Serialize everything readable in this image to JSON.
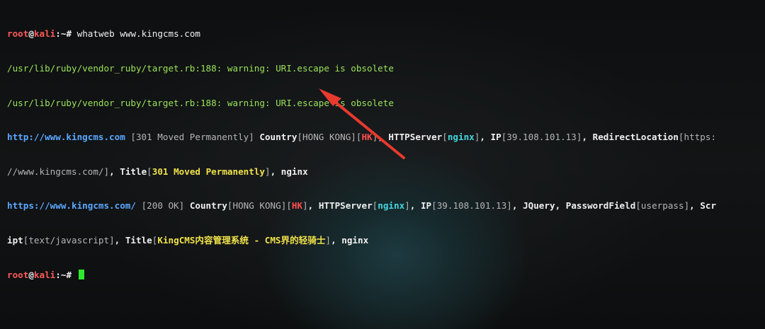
{
  "line1": {
    "user": "root",
    "at": "@",
    "host": "kali",
    "path": ":~# ",
    "cmd": "whatweb www.kingcms.com"
  },
  "line2": "/usr/lib/ruby/vendor_ruby/target.rb:188: warning: URI.escape is obsolete",
  "line3": "/usr/lib/ruby/vendor_ruby/target.rb:188: warning: URI.escape is obsolete",
  "r1": {
    "url": "http://www.kingcms.com",
    "status": " [301 Moved Permanently] ",
    "country_key": "Country",
    "country_val": "HONG KONG",
    "hk": "HK",
    "server_key": "HTTPServer",
    "server_val": "nginx",
    "ip_key": "IP",
    "ip_val": "39.108.101.13",
    "redirect_key": "RedirectLocation",
    "redirect_val_a": "https:",
    "redirect_val_b": "//www.kingcms.com/",
    "title_key": "Title",
    "title_val": "301 Moved Permanently",
    "tail": "nginx"
  },
  "r2": {
    "url": "https://www.kingcms.com/",
    "status": " [200 OK] ",
    "country_key": "Country",
    "country_val": "HONG KONG",
    "hk": "HK",
    "server_key": "HTTPServer",
    "server_val": "nginx",
    "ip_key": "IP",
    "ip_val": "39.108.101.13",
    "jquery": "JQuery",
    "pw_key": "PasswordField",
    "pw_val": "userpass",
    "script_key_a": "Scr",
    "script_key_b": "ipt",
    "script_val": "text/javascript",
    "title_key": "Title",
    "title_val": "KingCMS内容管理系统 - CMS界的轻骑士",
    "tail": "nginx"
  },
  "prompt": {
    "user": "root",
    "at": "@",
    "host": "kali",
    "path": ":~# "
  },
  "colors": {
    "accent_arrow": "#e8392f",
    "cursor": "#2ee82e"
  }
}
